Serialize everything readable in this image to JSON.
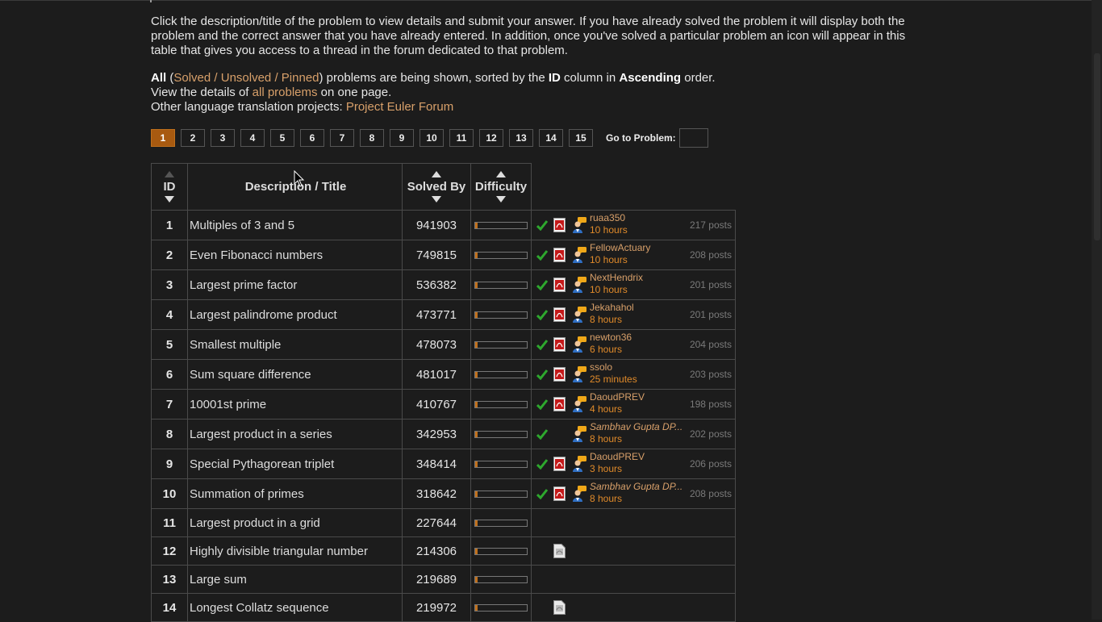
{
  "intro": {
    "text": "Click the description/title of the problem to view details and submit your answer. If you have already solved the problem it will display both the problem and the correct answer that you have already entered. In addition, once you've solved a particular problem an icon will appear in this table that gives you access to a thread in the forum dedicated to that problem."
  },
  "filter": {
    "all": "All",
    "open_paren": "(",
    "solved": "Solved",
    "sep1": " / ",
    "unsolved": "Unsolved",
    "sep2": " / ",
    "pinned": "Pinned",
    "close_text": ") problems are being shown, sorted by the ",
    "sort_col": "ID",
    "mid_text": " column in ",
    "order": "Ascending",
    "end_text": " order."
  },
  "view_all": {
    "pre": "View the details of ",
    "link": "all problems",
    "post": " on one page."
  },
  "translations": {
    "pre": "Other language translation projects: ",
    "link": "Project Euler Forum"
  },
  "pagination": {
    "pages": [
      "1",
      "2",
      "3",
      "4",
      "5",
      "6",
      "7",
      "8",
      "9",
      "10",
      "11",
      "12",
      "13",
      "14",
      "15"
    ],
    "active": "1",
    "goto_label": "Go to Problem:",
    "goto_value": ""
  },
  "table": {
    "headers": {
      "id": "ID",
      "title": "Description / Title",
      "solved_by": "Solved By",
      "difficulty": "Difficulty"
    },
    "rows": [
      {
        "id": "1",
        "title": "Multiples of 3 and 5",
        "solved_by": "941903",
        "difficulty": 0.05,
        "solved": true,
        "pdf": "red",
        "forum": true,
        "user": "ruaa350",
        "user_italic": false,
        "time": "10 hours",
        "posts": "217 posts"
      },
      {
        "id": "2",
        "title": "Even Fibonacci numbers",
        "solved_by": "749815",
        "difficulty": 0.05,
        "solved": true,
        "pdf": "red",
        "forum": true,
        "user": "FellowActuary",
        "user_italic": false,
        "time": "10 hours",
        "posts": "208 posts"
      },
      {
        "id": "3",
        "title": "Largest prime factor",
        "solved_by": "536382",
        "difficulty": 0.05,
        "solved": true,
        "pdf": "red",
        "forum": true,
        "user": "NextHendrix",
        "user_italic": false,
        "time": "10 hours",
        "posts": "201 posts"
      },
      {
        "id": "4",
        "title": "Largest palindrome product",
        "solved_by": "473771",
        "difficulty": 0.05,
        "solved": true,
        "pdf": "red",
        "forum": true,
        "user": "Jekahahol",
        "user_italic": false,
        "time": "8 hours",
        "posts": "201 posts"
      },
      {
        "id": "5",
        "title": "Smallest multiple",
        "solved_by": "478073",
        "difficulty": 0.05,
        "solved": true,
        "pdf": "red",
        "forum": true,
        "user": "newton36",
        "user_italic": false,
        "time": "6 hours",
        "posts": "204 posts"
      },
      {
        "id": "6",
        "title": "Sum square difference",
        "solved_by": "481017",
        "difficulty": 0.05,
        "solved": true,
        "pdf": "red",
        "forum": true,
        "user": "ssolo",
        "user_italic": false,
        "time": "25 minutes",
        "posts": "203 posts"
      },
      {
        "id": "7",
        "title": "10001st prime",
        "solved_by": "410767",
        "difficulty": 0.05,
        "solved": true,
        "pdf": "red",
        "forum": true,
        "user": "DaoudPREV",
        "user_italic": false,
        "time": "4 hours",
        "posts": "198 posts"
      },
      {
        "id": "8",
        "title": "Largest product in a series",
        "solved_by": "342953",
        "difficulty": 0.05,
        "solved": true,
        "pdf": "none",
        "forum": true,
        "user": "Sambhav Gupta DP...",
        "user_italic": true,
        "time": "8 hours",
        "posts": "202 posts"
      },
      {
        "id": "9",
        "title": "Special Pythagorean triplet",
        "solved_by": "348414",
        "difficulty": 0.05,
        "solved": true,
        "pdf": "red",
        "forum": true,
        "user": "DaoudPREV",
        "user_italic": false,
        "time": "3 hours",
        "posts": "206 posts"
      },
      {
        "id": "10",
        "title": "Summation of primes",
        "solved_by": "318642",
        "difficulty": 0.05,
        "solved": true,
        "pdf": "red",
        "forum": true,
        "user": "Sambhav Gupta DP...",
        "user_italic": true,
        "time": "8 hours",
        "posts": "208 posts"
      },
      {
        "id": "11",
        "title": "Largest product in a grid",
        "solved_by": "227644",
        "difficulty": 0.05,
        "solved": false,
        "pdf": "none",
        "forum": false,
        "user": "",
        "user_italic": false,
        "time": "",
        "posts": ""
      },
      {
        "id": "12",
        "title": "Highly divisible triangular number",
        "solved_by": "214306",
        "difficulty": 0.05,
        "solved": false,
        "pdf": "gray",
        "forum": false,
        "user": "",
        "user_italic": false,
        "time": "",
        "posts": ""
      },
      {
        "id": "13",
        "title": "Large sum",
        "solved_by": "219689",
        "difficulty": 0.05,
        "solved": false,
        "pdf": "none",
        "forum": false,
        "user": "",
        "user_italic": false,
        "time": "",
        "posts": ""
      },
      {
        "id": "14",
        "title": "Longest Collatz sequence",
        "solved_by": "219972",
        "difficulty": 0.05,
        "solved": false,
        "pdf": "gray",
        "forum": false,
        "user": "",
        "user_italic": false,
        "time": "",
        "posts": ""
      }
    ]
  },
  "icons": {
    "check": "check-icon",
    "pdf": "pdf-icon",
    "forum": "forum-thread-icon",
    "sort_up": "sort-asc-icon",
    "sort_down": "sort-desc-icon",
    "cursor": "mouse-cursor-icon"
  },
  "colors": {
    "background": "#1c1c1c",
    "link": "#d8a06a",
    "accent": "#a85a10",
    "check": "#2ea82e"
  }
}
